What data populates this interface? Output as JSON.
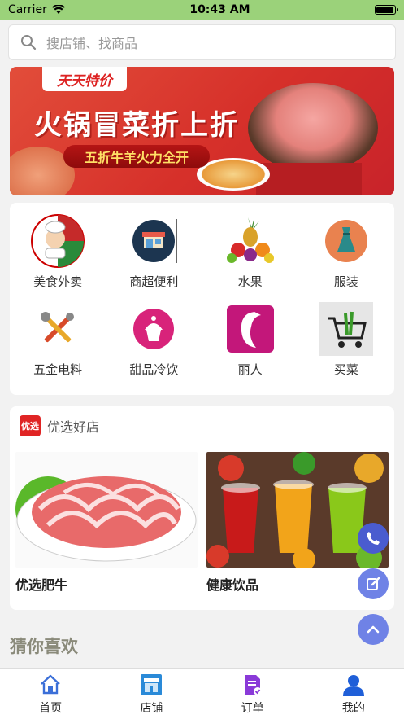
{
  "status_bar": {
    "carrier": "Carrier",
    "time": "10:43 AM"
  },
  "search": {
    "placeholder": "搜店铺、找商品"
  },
  "banner": {
    "tag": "天天特价",
    "headline": "火锅冒菜折上折",
    "subtitle": "五折牛羊火力全开"
  },
  "categories": [
    {
      "label": "美食外卖",
      "icon": "chef-icon"
    },
    {
      "label": "商超便利",
      "icon": "store-icon"
    },
    {
      "label": "水果",
      "icon": "fruit-icon"
    },
    {
      "label": "服装",
      "icon": "dress-icon"
    },
    {
      "label": "五金电料",
      "icon": "tools-icon"
    },
    {
      "label": "甜品冷饮",
      "icon": "cupcake-icon"
    },
    {
      "label": "丽人",
      "icon": "beauty-icon"
    },
    {
      "label": "买菜",
      "icon": "cart-icon"
    }
  ],
  "featured": {
    "logo_text": "优选",
    "title": "优选好店",
    "items": [
      {
        "name": "优选肥牛"
      },
      {
        "name": "健康饮品"
      }
    ]
  },
  "guess_title": "猜你喜欢",
  "tabs": [
    {
      "label": "首页",
      "icon": "home-icon"
    },
    {
      "label": "店铺",
      "icon": "shop-icon"
    },
    {
      "label": "订单",
      "icon": "order-icon"
    },
    {
      "label": "我的",
      "icon": "profile-icon"
    }
  ],
  "colors": {
    "status_bar": "#9bd27a",
    "fab": "#6f82e6",
    "tab_active": "#3b6fd8"
  }
}
